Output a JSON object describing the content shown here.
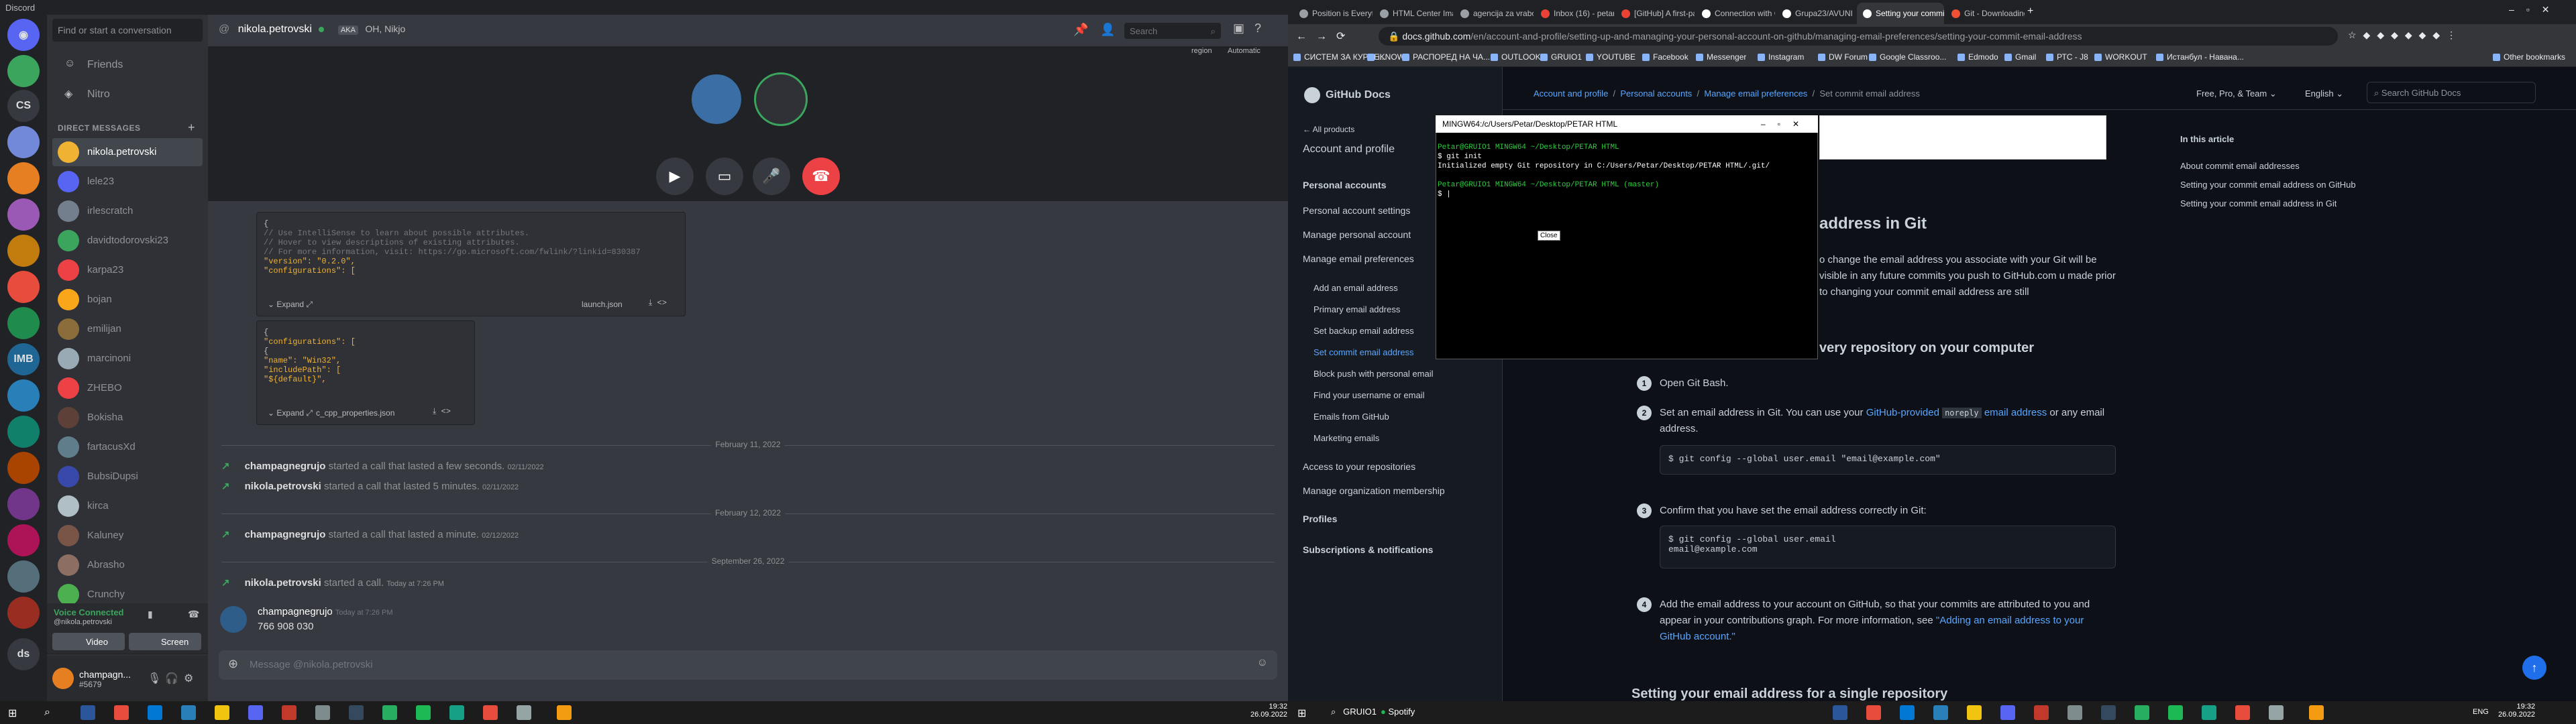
{
  "discord": {
    "window_title": "Discord",
    "guild_labels": [
      "CS",
      "IMB",
      "ds"
    ],
    "search_placeholder": "Find or start a conversation",
    "nav": [
      "Friends",
      "Nitro"
    ],
    "dm_header": "DIRECT MESSAGES",
    "dms": [
      "nikola.petrovski",
      "lele23",
      "irlescratch",
      "davidtodorovski23",
      "karpa23",
      "bojan",
      "emilijan",
      "marcinoni",
      "ZHEBO",
      "Bokisha",
      "fartacusXd",
      "BubsiDupsi",
      "kirca",
      "Kaluney",
      "Abrasho",
      "Crunchy"
    ],
    "voice_status": "Voice Connected",
    "voice_sub": "@nikola.petrovski",
    "voice_buttons": [
      "Video",
      "Screen"
    ],
    "user_name": "champagn...",
    "user_tag": "#5679",
    "header_name": "nikola.petrovski",
    "header_aka": "AKA",
    "header_aka_value": "OH, Nikjo",
    "header_search": "Search",
    "region_label": "region",
    "region_value": "Automatic",
    "code1": [
      "{",
      "    // Use IntelliSense to learn about possible attributes.",
      "    // Hover to view descriptions of existing attributes.",
      "    // For more information, visit: https://go.microsoft.com/fwlink/?linkid=830387",
      "    \"version\": \"0.2.0\",",
      "    \"configurations\": ["
    ],
    "code1_expand": "Expand",
    "code1_file": "launch.json",
    "code2": [
      "{",
      "    \"configurations\": [",
      "        {",
      "            \"name\": \"Win32\",",
      "            \"includePath\": [",
      "                \"${default}\","
    ],
    "code2_expand": "Expand",
    "code2_file": "c_cpp_properties.json",
    "date1": "February 11, 2022",
    "call1_user": "champagnegrujo",
    "call1_text": "started a call that lasted a few seconds.",
    "call1_time": "02/11/2022",
    "call2_user": "nikola.petrovski",
    "call2_text": "started a call that lasted 5 minutes.",
    "call2_time": "02/11/2022",
    "date2": "February 12, 2022",
    "call3_user": "champagnegrujo",
    "call3_text": "started a call that lasted a minute.",
    "call3_time": "02/12/2022",
    "date3": "September 26, 2022",
    "call4_user": "nikola.petrovski",
    "call4_text": "started a call.",
    "call4_time": "Today at 7:26 PM",
    "msg_user": "champagnegrujo",
    "msg_time": "Today at 7:26 PM",
    "msg_text": "766 908 030",
    "input_placeholder": "Message @nikola.petrovski"
  },
  "chrome": {
    "tabs": [
      "Position is Everything",
      "HTML Center Image -",
      "agencija za vrabotuv...",
      "Inbox (16) - petargru...",
      "[GitHub] A first-party",
      "Connection with Git",
      "Grupa23/AVUNI",
      "Setting your commit...",
      "Git - Downloading P..."
    ],
    "url_host": "docs.github.com",
    "url_path": "/en/account-and-profile/setting-up-and-managing-your-personal-account-on-github/managing-email-preferences/setting-your-commit-email-address",
    "bookmarks": [
      "СИСТЕМ ЗА КУРСЕ...",
      "iKNOW",
      "РАСПОРЕД НА ЧА...",
      "OUTLOOK",
      "GRUIO1",
      "YOUTUBE",
      "Facebook",
      "Messenger",
      "Instagram",
      "DW Forum",
      "Google Classroo...",
      "Edmodo",
      "Gmail",
      "РТС - Ј8",
      "WORKOUT",
      "Истанбул - Навана..."
    ],
    "other_bookmarks": "Other bookmarks"
  },
  "docs": {
    "logo": "GitHub Docs",
    "breadcrumb": [
      "Account and profile",
      "Personal accounts",
      "Manage email preferences",
      "Set commit email address"
    ],
    "top_links": [
      "Free, Pro, & Team",
      "English"
    ],
    "search_placeholder": "Search GitHub Docs",
    "all_products": "All products",
    "section": "Account and profile",
    "side_items": [
      "Personal accounts",
      "Personal account settings",
      "Manage personal account",
      "Manage email preferences"
    ],
    "side_sub": [
      "Add an email address",
      "Primary email address",
      "Set backup email address",
      "Set commit email address",
      "Block push with personal email",
      "Find your username or email",
      "Emails from GitHub",
      "Marketing emails"
    ],
    "side_more": [
      "Access to your repositories",
      "Manage organization membership",
      "Profiles",
      "Subscriptions & notifications"
    ],
    "heading1": "address in Git",
    "para1": "o change the email address you associate with your Git will be visible in any future commits you push to GitHub.com u made prior to changing your commit email address are still",
    "heading2": "very repository on your computer",
    "step1": "Open Git Bash.",
    "step2_a": "Set an email address in Git. You can use your",
    "step2_link1": "GitHub-provided",
    "step2_code": "noreply",
    "step2_link2": "email address",
    "step2_b": "or any email address.",
    "cmd1": "$ git config --global user.email \"email@example.com\"",
    "step3": "Confirm that you have set the email address correctly in Git:",
    "cmd2a": "$ git config --global user.email",
    "cmd2b": "email@example.com",
    "step4_a": "Add the email address to your account on GitHub, so that your commits are attributed to you and appear in your contributions graph. For more information, see",
    "step4_link": "\"Adding an email address to your GitHub account.\"",
    "heading3": "Setting your email address for a single repository",
    "toc_title": "In this article",
    "toc": [
      "About commit email addresses",
      "Setting your commit email address on GitHub",
      "Setting your commit email address in Git"
    ]
  },
  "gitbash": {
    "title": "MINGW64:/c/Users/Petar/Desktop/PETAR HTML",
    "prompt1": "Petar@GRUIO1 MINGW64 ~/Desktop/PETAR HTML",
    "cmd1": "$ git init",
    "out1": "Initialized empty Git repository in C:/Users/Petar/Desktop/PETAR HTML/.git/",
    "prompt2": "Petar@GRUIO1 MINGW64 ~/Desktop/PETAR HTML (master)",
    "cmd2": "$ |",
    "cursor_tip": "Close"
  },
  "taskbar": {
    "left_clock": "19:32",
    "left_date": "26.09.2022",
    "right_clock": "19:32",
    "right_date": "26.09.2022",
    "right_search": "GRUIO1",
    "right_app": "Spotify",
    "lang": "ENG"
  }
}
